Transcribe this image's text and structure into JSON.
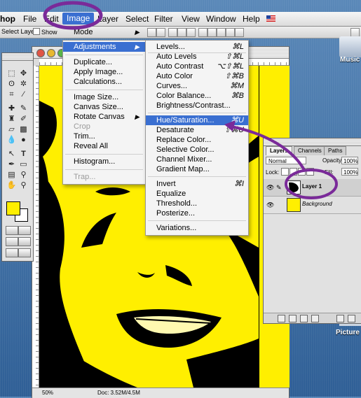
{
  "menubar": {
    "app_name": "hop",
    "items": [
      "File",
      "Edit",
      "Image",
      "Layer",
      "Select",
      "Filter",
      "View",
      "Window",
      "Help"
    ],
    "active_item": "Image"
  },
  "options_bar": {
    "tool_label": "Select Layer",
    "checkbox_label": "Show"
  },
  "desktop": {
    "icon_music": "Music",
    "icon_picture": "Picture"
  },
  "image_menu": {
    "items": [
      {
        "label": "Mode",
        "submenu": true,
        "enabled": true
      },
      {
        "label": "Adjustments",
        "submenu": true,
        "enabled": true,
        "highlighted": true
      },
      {
        "label": "Duplicate...",
        "enabled": true
      },
      {
        "label": "Apply Image...",
        "enabled": true
      },
      {
        "label": "Calculations...",
        "enabled": true
      },
      {
        "label": "Image Size...",
        "enabled": true
      },
      {
        "label": "Canvas Size...",
        "enabled": true
      },
      {
        "label": "Rotate Canvas",
        "submenu": true,
        "enabled": true
      },
      {
        "label": "Crop",
        "enabled": false
      },
      {
        "label": "Trim...",
        "enabled": true
      },
      {
        "label": "Reveal All",
        "enabled": true
      },
      {
        "label": "Histogram...",
        "enabled": true
      },
      {
        "label": "Trap...",
        "enabled": false
      }
    ]
  },
  "adjustments_menu": {
    "items": [
      {
        "label": "Levels...",
        "shortcut": "⌘L"
      },
      {
        "label": "Auto Levels",
        "shortcut": "⇧⌘L"
      },
      {
        "label": "Auto Contrast",
        "shortcut": "⌥⇧⌘L"
      },
      {
        "label": "Auto Color",
        "shortcut": "⇧⌘B"
      },
      {
        "label": "Curves...",
        "shortcut": "⌘M"
      },
      {
        "label": "Color Balance...",
        "shortcut": "⌘B"
      },
      {
        "label": "Brightness/Contrast...",
        "shortcut": ""
      },
      {
        "label": "Hue/Saturation...",
        "shortcut": "⌘U",
        "highlighted": true
      },
      {
        "label": "Desaturate",
        "shortcut": "⇧⌘U"
      },
      {
        "label": "Replace Color...",
        "shortcut": ""
      },
      {
        "label": "Selective Color...",
        "shortcut": ""
      },
      {
        "label": "Channel Mixer...",
        "shortcut": ""
      },
      {
        "label": "Gradient Map...",
        "shortcut": ""
      },
      {
        "label": "Invert",
        "shortcut": "⌘I"
      },
      {
        "label": "Equalize",
        "shortcut": ""
      },
      {
        "label": "Threshold...",
        "shortcut": ""
      },
      {
        "label": "Posterize...",
        "shortcut": ""
      },
      {
        "label": "Variations...",
        "shortcut": ""
      }
    ]
  },
  "document": {
    "zoom": "50%",
    "doc_size": "Doc: 3.52M/4.5M"
  },
  "layers_panel": {
    "tabs": [
      "Layers",
      "Channels",
      "Paths"
    ],
    "active_tab": "Layers",
    "blend_mode": "Normal",
    "opacity_label": "Opacity:",
    "opacity_value": "100%",
    "lock_label": "Lock:",
    "fill_label": "Fill:",
    "fill_value": "100%",
    "layers": [
      {
        "name": "Layer 1",
        "selected": true
      },
      {
        "name": "Background",
        "selected": false
      }
    ]
  },
  "colors": {
    "foreground": "#ffef00",
    "background": "#ffffff",
    "annotation": "#7a2a99",
    "menu_highlight": "#3a6fd1"
  }
}
